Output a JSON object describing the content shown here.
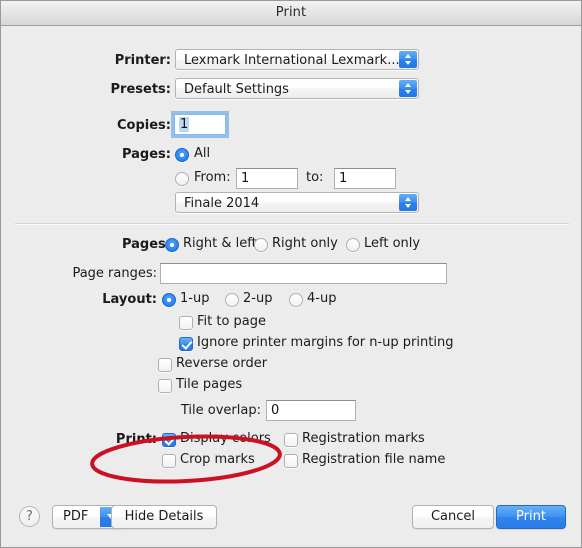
{
  "window": {
    "title": "Print"
  },
  "printer": {
    "label": "Printer:",
    "value": "Lexmark International Lexmark...",
    "stepper_icon": "up-down-arrows-icon"
  },
  "presets": {
    "label": "Presets:",
    "value": "Default Settings",
    "stepper_icon": "up-down-arrows-icon"
  },
  "copies": {
    "label": "Copies:",
    "value": "1"
  },
  "pages_basic": {
    "label": "Pages:",
    "all_label": "All",
    "all_selected": true,
    "from_label": "From:",
    "from_value": "1",
    "to_label": "to:",
    "to_value": "1",
    "range_selected": false
  },
  "pane_popup": {
    "value": "Finale 2014",
    "stepper_icon": "up-down-arrows-icon"
  },
  "pages_side": {
    "label": "Pages:",
    "options": [
      {
        "label": "Right & left",
        "selected": true
      },
      {
        "label": "Right only",
        "selected": false
      },
      {
        "label": "Left only",
        "selected": false
      }
    ]
  },
  "page_ranges": {
    "label": "Page ranges:",
    "value": "",
    "placeholder": ""
  },
  "layout": {
    "label": "Layout:",
    "options": [
      {
        "label": "1-up",
        "selected": true
      },
      {
        "label": "2-up",
        "selected": false
      },
      {
        "label": "4-up",
        "selected": false
      }
    ]
  },
  "options": [
    {
      "label": "Fit to page",
      "checked": false
    },
    {
      "label": "Ignore printer margins for n-up printing",
      "checked": true
    },
    {
      "label": "Reverse order",
      "checked": false
    },
    {
      "label": "Tile pages",
      "checked": false
    }
  ],
  "tile_overlap": {
    "label": "Tile overlap:",
    "value": "0"
  },
  "print_options": {
    "label": "Print:",
    "items": [
      {
        "label": "Display colors",
        "checked": true
      },
      {
        "label": "Crop marks",
        "checked": false
      },
      {
        "label": "Registration marks",
        "checked": false
      },
      {
        "label": "Registration file name",
        "checked": false
      }
    ]
  },
  "footer": {
    "help_label": "?",
    "pdf_label": "PDF",
    "pdf_chevron_icon": "chevron-down-icon",
    "hide_details_label": "Hide Details",
    "cancel_label": "Cancel",
    "print_label": "Print"
  },
  "annotation": {
    "shape": "red-ellipse-highlight",
    "color": "#cc1122",
    "target": "Display colors"
  },
  "colors": {
    "accent_blue": "#2d87ee",
    "window_bg": "#ececec",
    "annotation_red": "#cc1122"
  }
}
